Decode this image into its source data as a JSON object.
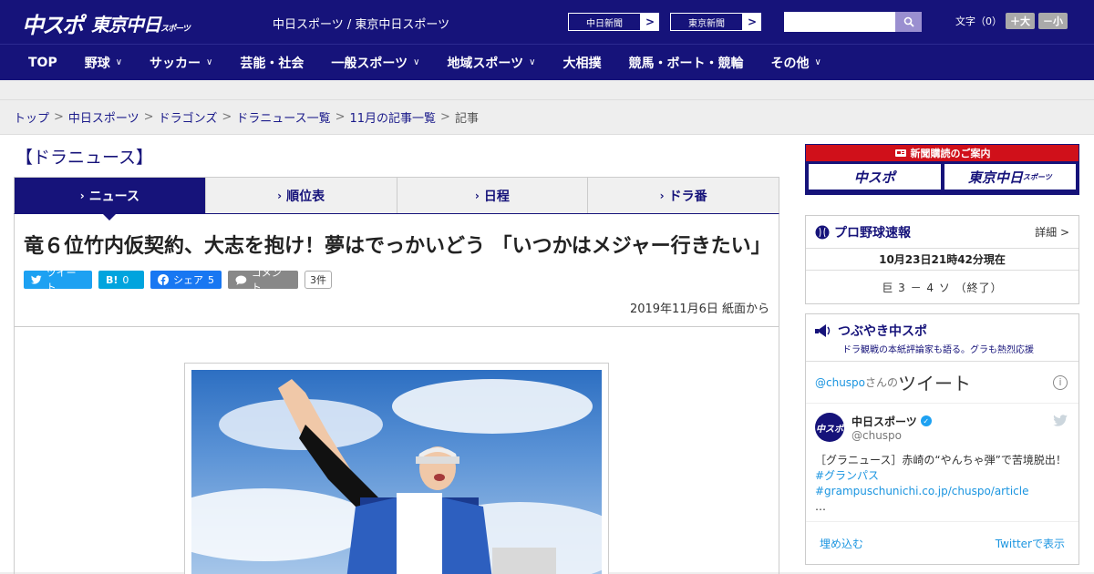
{
  "header": {
    "logo_main": "中スポ",
    "logo_sub": "東京中日",
    "logo_sub_small": "スポーツ",
    "site_title": "中日スポーツ / 東京中日スポーツ",
    "ext_links": [
      {
        "label": "中日新聞"
      },
      {
        "label": "東京新聞"
      }
    ],
    "search_placeholder": "",
    "font_size_label": "文字（0）",
    "font_plus": "＋大",
    "font_minus": "－小"
  },
  "nav": {
    "items": [
      {
        "label": "TOP",
        "has_menu": false
      },
      {
        "label": "野球",
        "has_menu": true
      },
      {
        "label": "サッカー",
        "has_menu": true
      },
      {
        "label": "芸能・社会",
        "has_menu": false
      },
      {
        "label": "一般スポーツ",
        "has_menu": true
      },
      {
        "label": "地域スポーツ",
        "has_menu": true
      },
      {
        "label": "大相撲",
        "has_menu": false
      },
      {
        "label": "競馬・ボート・競輪",
        "has_menu": false
      },
      {
        "label": "その他",
        "has_menu": true
      }
    ]
  },
  "breadcrumb": {
    "items": [
      "トップ",
      "中日スポーツ",
      "ドラゴンズ",
      "ドラニュース一覧",
      "11月の記事一覧"
    ],
    "current": "記事"
  },
  "main": {
    "section_title": "【ドラニュース】",
    "tabs": [
      {
        "label": "ニュース",
        "active": true
      },
      {
        "label": "順位表",
        "active": false
      },
      {
        "label": "日程",
        "active": false
      },
      {
        "label": "ドラ番",
        "active": false
      }
    ],
    "headline": "竜６位竹内仮契約、大志を抱け！夢はでっかいどう 「いつかはメジャー行きたい」",
    "share": {
      "tweet_label": "ツイート",
      "hatena_label": "B!",
      "hatena_count": "0",
      "facebook_label": "シェア",
      "facebook_count": "5",
      "comment_label": "コメント",
      "comment_count": "3件"
    },
    "date": "2019年11月6日 紙面から"
  },
  "sidebar": {
    "subscribe": {
      "title": "新聞購読のご案内",
      "logo_a": "中スポ",
      "logo_b": "東京中日",
      "logo_b_small": "スポーツ"
    },
    "baseball": {
      "title": "プロ野球速報",
      "more": "詳細 >",
      "time": "10月23日21時42分現在",
      "score": "巨 3 － 4 ソ （終了）"
    },
    "twitter": {
      "title": "つぶやき中スポ",
      "subtitle": "ドラ観戦の本紙評論家も語る。グラも熱烈応援",
      "handle_link": "@chuspo",
      "handle_suffix": "さんの",
      "big_label": "ツイート",
      "info": "i",
      "tweet": {
        "avatar_text": "中スポ",
        "name": "中日スポーツ",
        "handle": "@chuspo",
        "text": "［グラニュース］赤崎の“やんちゃ弾”で苦境脱出！",
        "links": "#グランパス #grampuschunichi.co.jp/chuspo/article",
        "ellipsis": "…"
      },
      "embed_label": "埋め込む",
      "view_on_label": "Twitterで表示"
    }
  }
}
